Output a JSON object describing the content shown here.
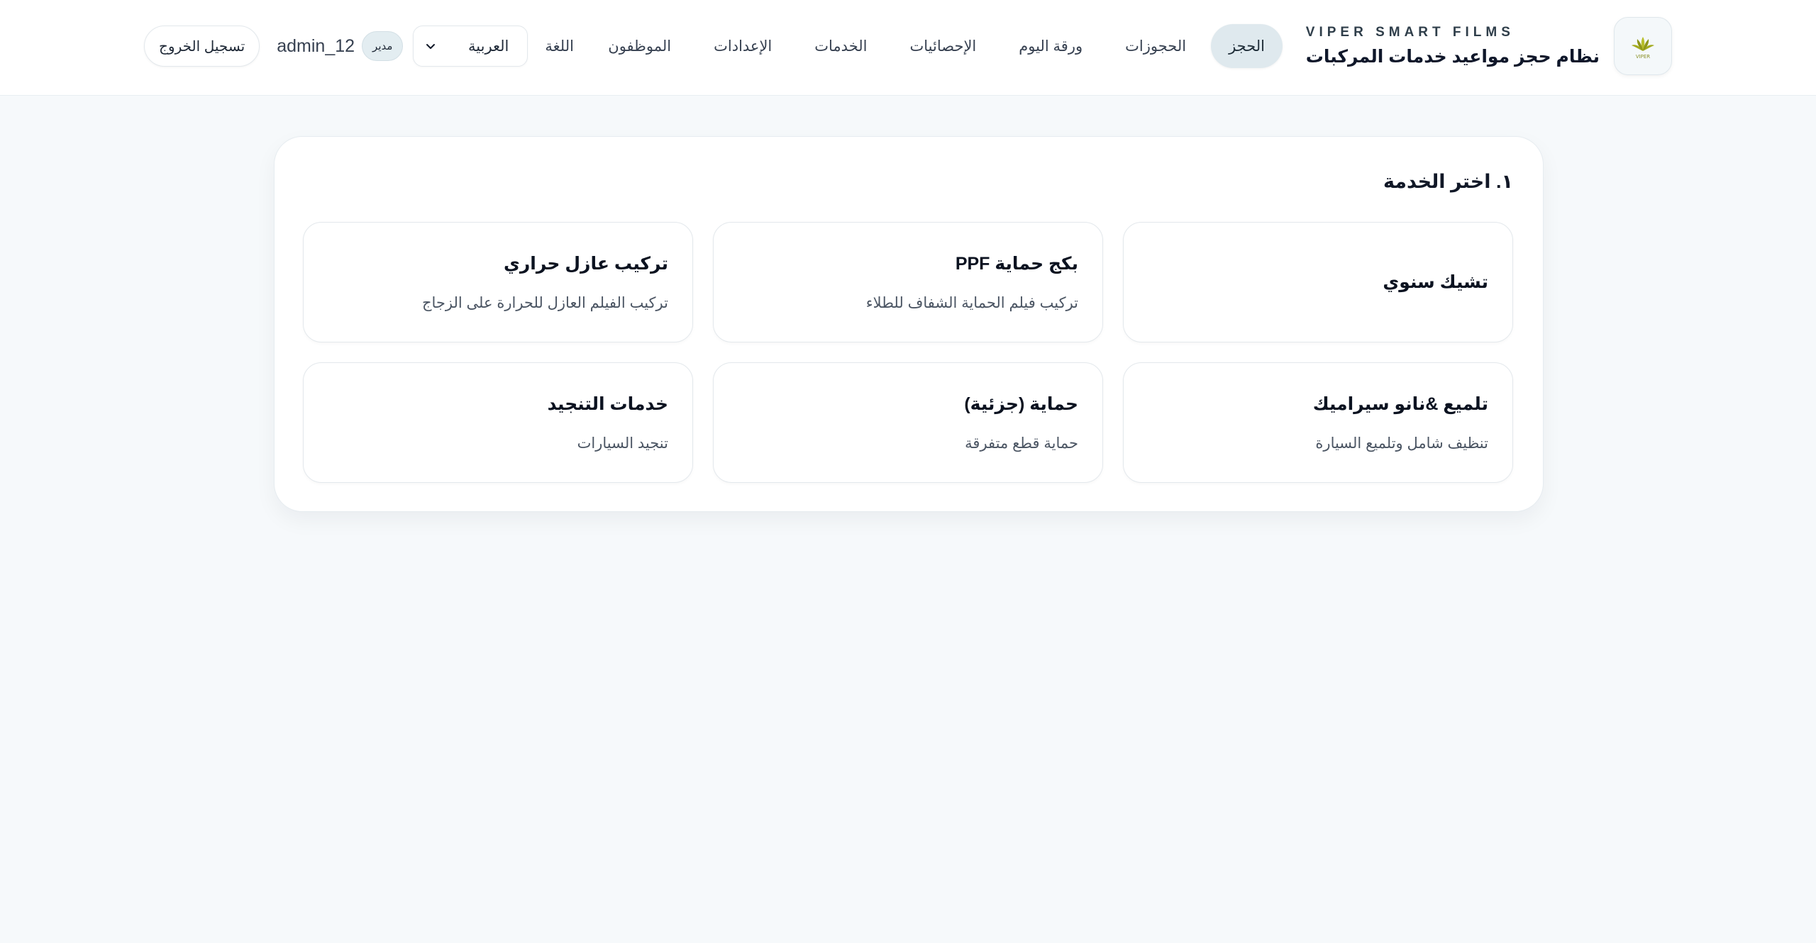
{
  "brand": {
    "small_title": "VIPER SMART FILMS",
    "title": "نظام حجز مواعيد خدمات المركبات",
    "logo_icon": "viper-leaf-logo-icon"
  },
  "nav": {
    "items": [
      {
        "label": "الحجز",
        "active": true
      },
      {
        "label": "الحجوزات"
      },
      {
        "label": "ورقة اليوم"
      },
      {
        "label": "الإحصائيات"
      },
      {
        "label": "الخدمات"
      },
      {
        "label": "الإعدادات"
      },
      {
        "label": "الموظفون"
      }
    ]
  },
  "controls": {
    "language_label": "اللغة",
    "language_value": "العربية",
    "username": "admin_12",
    "role": "مدير",
    "logout_label": "تسجيل الخروج"
  },
  "booking": {
    "step_title": "١. اختر الخدمة",
    "services": [
      {
        "name": "تشيك سنوي",
        "desc": ""
      },
      {
        "name": "بكج حماية PPF",
        "desc": "تركيب فيلم الحماية الشفاف للطلاء"
      },
      {
        "name": "تركيب عازل حراري",
        "desc": "تركيب الفيلم العازل للحرارة على الزجاج"
      },
      {
        "name": "تلميع &نانو سيراميك",
        "desc": "تنظيف شامل وتلميع السيارة"
      },
      {
        "name": "حماية (جزئية)",
        "desc": "حماية قطع متفرقة"
      },
      {
        "name": "خدمات التنجيد",
        "desc": "تنجيد السيارات"
      }
    ]
  },
  "colors": {
    "page_bg": "#f6f9fb",
    "active_nav_bg": "#dfe9ee",
    "logo_leaf": "#9ba31c"
  }
}
